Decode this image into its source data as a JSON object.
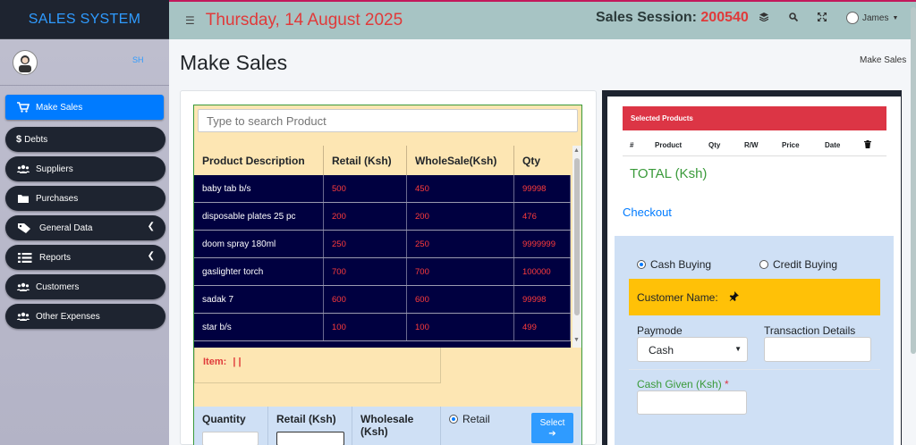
{
  "brand": "SALES SYSTEM",
  "user": {
    "initials": "SH",
    "name": "James"
  },
  "nav": [
    {
      "label": "Make Sales",
      "icon": "cart-icon"
    },
    {
      "label": "Debts",
      "icon": "dollar-icon"
    },
    {
      "label": "Suppliers",
      "icon": "users-icon"
    },
    {
      "label": "Purchases",
      "icon": "folder-icon"
    },
    {
      "label": "General Data",
      "icon": "tags-icon"
    },
    {
      "label": "Reports",
      "icon": "list-icon"
    },
    {
      "label": "Customers",
      "icon": "users-icon"
    },
    {
      "label": "Other Expenses",
      "icon": "users-icon"
    }
  ],
  "topbar": {
    "date": "Thursday, 14 August 2025",
    "session_label": "Sales Session:",
    "session_number": "200540"
  },
  "page": {
    "title": "Make Sales",
    "breadcrumb": "Make Sales"
  },
  "search": {
    "placeholder": "Type to search Product"
  },
  "products": {
    "columns": [
      "Product Description",
      "Retail (Ksh)",
      "WholeSale(Ksh)",
      "Qty"
    ],
    "rows": [
      [
        "baby tab b/s",
        "500",
        "450",
        "99998"
      ],
      [
        "disposable plates 25 pc",
        "200",
        "200",
        "476"
      ],
      [
        "doom spray 180ml",
        "250",
        "250",
        "9999999"
      ],
      [
        "gaslighter torch",
        "700",
        "700",
        "100000"
      ],
      [
        "sadak 7",
        "600",
        "600",
        "99998"
      ],
      [
        "star b/s",
        "100",
        "100",
        "499"
      ]
    ]
  },
  "item": {
    "label": "Item:",
    "value": "| |"
  },
  "entry": {
    "quantity_label": "Quantity",
    "retail_label": "Retail (Ksh)",
    "wholesale_label": "Wholesale (Ksh)",
    "retail_option": "Retail",
    "select_button": "Select",
    "select_arrow": "➔"
  },
  "selected": {
    "header": "Selected Products",
    "columns": [
      "#",
      "Product",
      "Qty",
      "R/W",
      "Price",
      "Date"
    ],
    "total_label": "TOTAL (Ksh)",
    "checkout": "Checkout"
  },
  "payment": {
    "cash_buying": "Cash Buying",
    "credit_buying": "Credit Buying",
    "customer_name_label": "Customer Name:",
    "paymode_label": "Paymode",
    "paymode_value": "Cash",
    "transaction_label": "Transaction Details",
    "cash_given_label": "Cash Given (Ksh)",
    "required_mark": "*"
  },
  "colors": {
    "accent": "#007bff",
    "danger": "#dc3545",
    "dark": "#1e2430",
    "warning": "#ffc107"
  }
}
